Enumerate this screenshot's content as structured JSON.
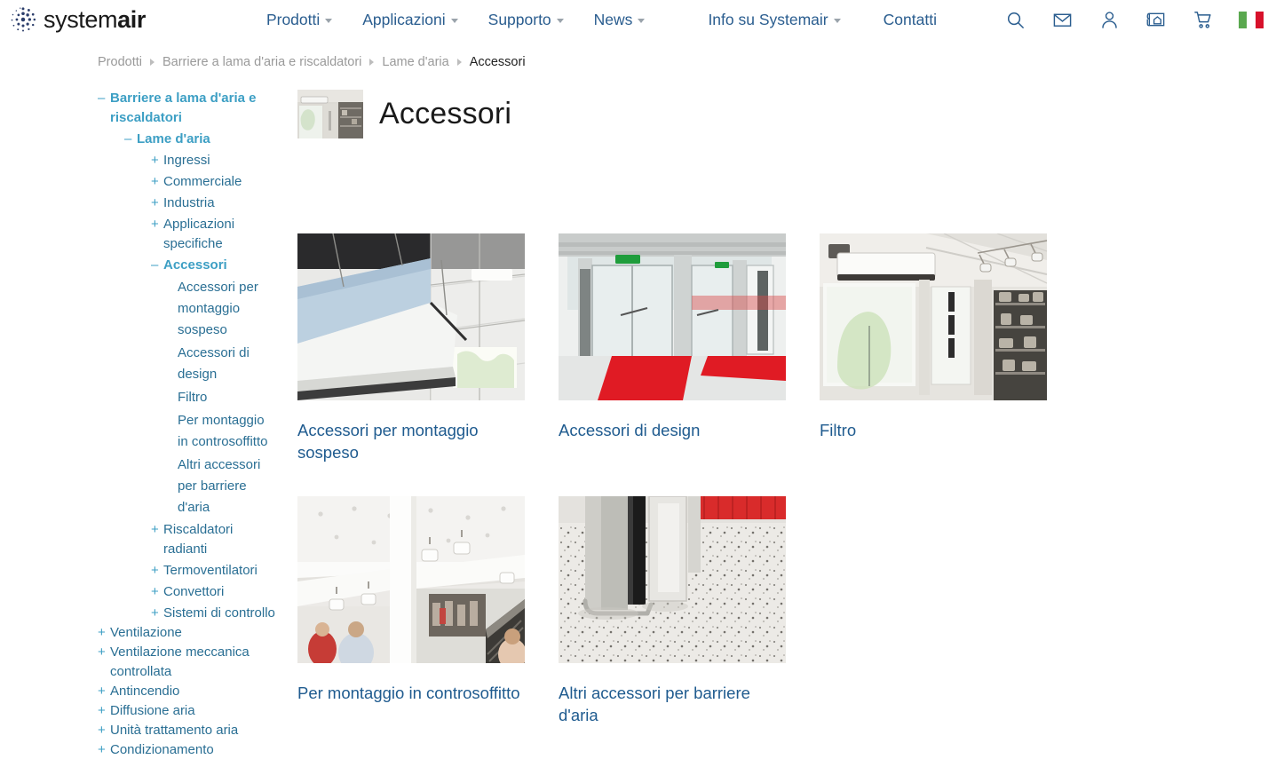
{
  "header": {
    "logo": {
      "light": "system",
      "bold": "air",
      "icon": "systemair-logo-icon"
    },
    "nav": [
      {
        "label": "Prodotti",
        "has_caret": true
      },
      {
        "label": "Applicazioni",
        "has_caret": true
      },
      {
        "label": "Supporto",
        "has_caret": true
      },
      {
        "label": "News",
        "has_caret": true
      },
      {
        "label": "Info su Systemair",
        "has_caret": true
      },
      {
        "label": "Contatti",
        "has_caret": false
      }
    ],
    "icons": [
      {
        "name": "search-icon"
      },
      {
        "name": "mail-icon"
      },
      {
        "name": "user-account-icon"
      },
      {
        "name": "blueprint-icon"
      },
      {
        "name": "shopping-cart-icon"
      },
      {
        "name": "italy-flag-icon"
      }
    ]
  },
  "breadcrumb": [
    {
      "label": "Prodotti",
      "current": false
    },
    {
      "label": "Barriere a lama d'aria e riscaldatori",
      "current": false
    },
    {
      "label": "Lame d'aria",
      "current": false
    },
    {
      "label": "Accessori",
      "current": true
    }
  ],
  "sidebar": {
    "items": [
      {
        "label": "Barriere a lama d'aria e riscaldatori",
        "sign": "–",
        "level": 0,
        "active": true,
        "leaf": false
      },
      {
        "label": "Lame d'aria",
        "sign": "–",
        "level": 1,
        "active": true,
        "leaf": false
      },
      {
        "label": "Ingressi",
        "sign": "+",
        "level": 2,
        "active": false,
        "leaf": false
      },
      {
        "label": "Commerciale",
        "sign": "+",
        "level": 2,
        "active": false,
        "leaf": false
      },
      {
        "label": "Industria",
        "sign": "+",
        "level": 2,
        "active": false,
        "leaf": false
      },
      {
        "label": "Applicazioni specifiche",
        "sign": "+",
        "level": 2,
        "active": false,
        "leaf": false
      },
      {
        "label": "Accessori",
        "sign": "–",
        "level": 2,
        "active": true,
        "leaf": false
      },
      {
        "label": "Accessori per montaggio sospeso",
        "sign": "",
        "level": 3,
        "active": false,
        "leaf": true
      },
      {
        "label": "Accessori di design",
        "sign": "",
        "level": 3,
        "active": false,
        "leaf": true
      },
      {
        "label": "Filtro",
        "sign": "",
        "level": 3,
        "active": false,
        "leaf": true
      },
      {
        "label": "Per montaggio in controsoffitto",
        "sign": "",
        "level": 3,
        "active": false,
        "leaf": true
      },
      {
        "label": "Altri accessori per barriere d'aria",
        "sign": "",
        "level": 3,
        "active": false,
        "leaf": true
      },
      {
        "label": "Riscaldatori radianti",
        "sign": "+",
        "level": 2,
        "active": false,
        "leaf": false
      },
      {
        "label": "Termoventilatori",
        "sign": "+",
        "level": 2,
        "active": false,
        "leaf": false
      },
      {
        "label": "Convettori",
        "sign": "+",
        "level": 2,
        "active": false,
        "leaf": false
      },
      {
        "label": "Sistemi di controllo",
        "sign": "+",
        "level": 2,
        "active": false,
        "leaf": false
      },
      {
        "label": "Ventilazione",
        "sign": "+",
        "level": 0,
        "active": false,
        "leaf": false
      },
      {
        "label": "Ventilazione meccanica controllata",
        "sign": "+",
        "level": 0,
        "active": false,
        "leaf": false
      },
      {
        "label": "Antincendio",
        "sign": "+",
        "level": 0,
        "active": false,
        "leaf": false
      },
      {
        "label": "Diffusione aria",
        "sign": "+",
        "level": 0,
        "active": false,
        "leaf": false
      },
      {
        "label": "Unità trattamento aria",
        "sign": "+",
        "level": 0,
        "active": false,
        "leaf": false
      },
      {
        "label": "Condizionamento",
        "sign": "+",
        "level": 0,
        "active": false,
        "leaf": false
      }
    ]
  },
  "main": {
    "title": "Accessori",
    "thumbnail_alt": "air-curtain-shop-photo",
    "cards": [
      {
        "title": "Accessori per montaggio sospeso",
        "image": "suspended-mounting-air-curtain-photo"
      },
      {
        "title": "Accessori di design",
        "image": "entrance-doors-red-mat-photo"
      },
      {
        "title": "Filtro",
        "image": "shop-interior-air-curtain-photo"
      },
      {
        "title": "Per montaggio in controsoffitto",
        "image": "mall-escalator-ceiling-photo"
      },
      {
        "title": "Altri accessori per barriere d'aria",
        "image": "floor-mounted-column-photo"
      }
    ]
  },
  "colors": {
    "nav_link": "#2a5d8f",
    "sidebar_link": "#2a6f94",
    "sidebar_active": "#3d9fc4",
    "card_link": "#1f5b8f",
    "breadcrumb": "#9a9a9a",
    "flag_green": "#5aa84f",
    "flag_red": "#d7112b"
  }
}
